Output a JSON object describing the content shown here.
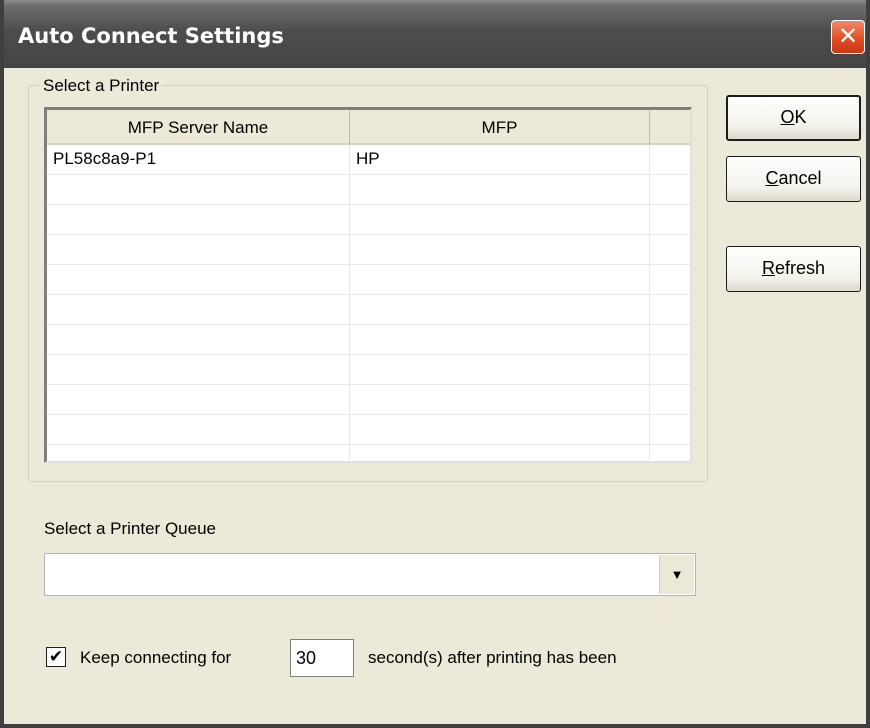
{
  "window": {
    "title": "Auto Connect Settings",
    "close_glyph": "✕"
  },
  "printer_group": {
    "label": "Select a Printer",
    "columns": [
      "MFP Server Name",
      "MFP",
      ""
    ],
    "rows": [
      [
        "PL58c8a9-P1",
        "HP",
        ""
      ]
    ]
  },
  "buttons": {
    "ok": {
      "accel": "O",
      "rest": "K"
    },
    "cancel": {
      "accel": "C",
      "rest": "ancel"
    },
    "refresh": {
      "accel": "R",
      "rest": "efresh"
    }
  },
  "queue": {
    "label": "Select a Printer Queue",
    "value": "",
    "arrow_glyph": "▼"
  },
  "keep": {
    "checked": true,
    "check_glyph": "✔",
    "label": "Keep connecting for",
    "seconds_value": "30",
    "suffix": "second(s) after printing has been"
  },
  "colors": {
    "title_bar": "#4D4D4D",
    "dialog_bg": "#ECE9D8",
    "close_button": "#DF4A21"
  },
  "icons": {
    "close": "close-icon",
    "dropdown": "chevron-down-icon",
    "checkmark": "checkmark-icon"
  }
}
